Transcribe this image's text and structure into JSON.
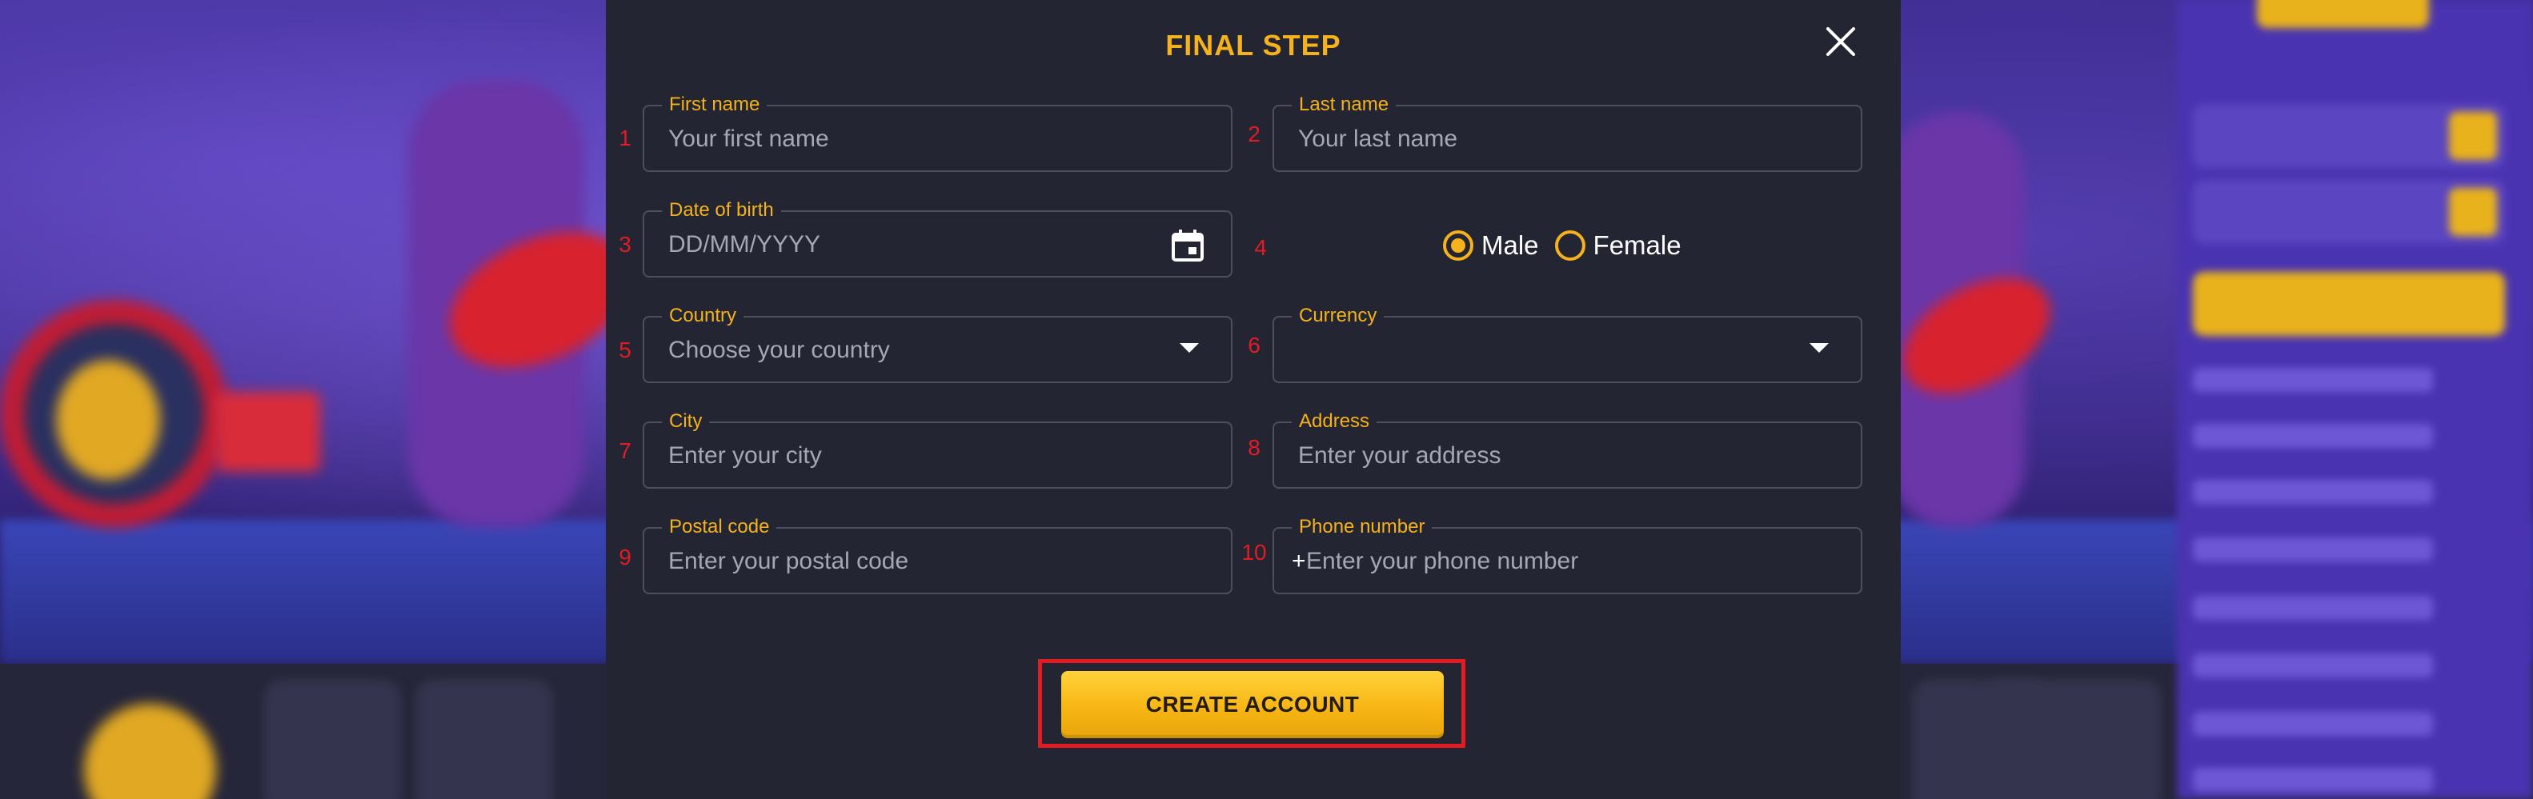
{
  "modal": {
    "title": "FINAL STEP",
    "close_icon": "close-icon"
  },
  "fields": {
    "first_name": {
      "number": "1",
      "label": "First name",
      "placeholder": "Your first name",
      "value": ""
    },
    "last_name": {
      "number": "2",
      "label": "Last name",
      "placeholder": "Your last name",
      "value": ""
    },
    "date_of_birth": {
      "number": "3",
      "label": "Date of birth",
      "placeholder": "DD/MM/YYYY",
      "value": "",
      "icon": "calendar-icon"
    },
    "gender": {
      "number": "4",
      "options": [
        {
          "label": "Male",
          "selected": true
        },
        {
          "label": "Female",
          "selected": false
        }
      ]
    },
    "country": {
      "number": "5",
      "label": "Country",
      "placeholder": "Choose your country",
      "value": "",
      "icon": "chevron-down-icon"
    },
    "currency": {
      "number": "6",
      "label": "Currency",
      "value": "",
      "icon": "chevron-down-icon"
    },
    "city": {
      "number": "7",
      "label": "City",
      "placeholder": "Enter your city",
      "value": ""
    },
    "address": {
      "number": "8",
      "label": "Address",
      "placeholder": "Enter your address",
      "value": ""
    },
    "postal_code": {
      "number": "9",
      "label": "Postal code",
      "placeholder": "Enter your postal code",
      "value": ""
    },
    "phone_number": {
      "number": "10",
      "label": "Phone number",
      "prefix": "+",
      "placeholder": "Enter your phone number",
      "value": ""
    }
  },
  "actions": {
    "create_account_label": "CREATE ACCOUNT"
  },
  "colors": {
    "accent": "#f5b21c",
    "annotation": "#e31b23",
    "modal_background": "#242532",
    "field_border": "#4d4f60",
    "placeholder_text": "#a6a7b4"
  }
}
